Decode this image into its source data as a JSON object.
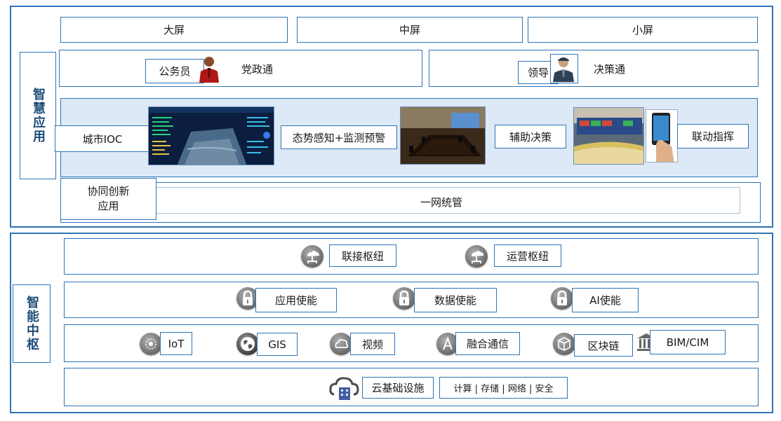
{
  "smart_app": {
    "section_title": "智慧应用",
    "screens": {
      "large": "大屏",
      "medium": "中屏",
      "small": "小屏"
    },
    "row2": {
      "civil_servant": "公务员",
      "party_gov": "党政通",
      "leader": "领导",
      "decision": "决策通"
    },
    "row3": {
      "city_ioc": "城市IOC",
      "situation": "态势感知+监测预警",
      "assist": "辅助决策",
      "linkage": "联动指挥"
    },
    "row4": {
      "collab": "协同创新\n应用",
      "unified": "一网统管"
    }
  },
  "smart_hub": {
    "section_title": "智能中枢",
    "row1": {
      "connect": "联接枢纽",
      "operate": "运营枢纽"
    },
    "row2": {
      "app_enable": "应用使能",
      "data_enable": "数据使能",
      "ai_enable": "AI使能"
    },
    "row3": {
      "iot": "IoT",
      "gis": "GIS",
      "video": "视频",
      "comm": "融合通信",
      "blockchain": "区块链",
      "bim": "BIM/CIM"
    },
    "row4": {
      "cloud": "云基础设施",
      "cloud_detail": "计算 | 存储 | 网络 | 安全"
    }
  },
  "icons": {
    "civil_servant": "person-red-tie-icon",
    "leader": "person-uniform-icon",
    "connect": "cloud-network-icon",
    "operate": "cloud-network-icon",
    "app_enable": "lock-icon",
    "data_enable": "lock-icon",
    "ai_enable": "lock-icon",
    "iot": "chip-icon",
    "gis": "globe-icon",
    "video": "cloud-icon",
    "comm": "signal-icon",
    "blockchain": "cube-icon",
    "bim": "building-icon",
    "cloud": "cloud-building-icon"
  },
  "colors": {
    "border": "#2e75b6",
    "panel": "#dde9f7",
    "title": "#1f4e79"
  }
}
